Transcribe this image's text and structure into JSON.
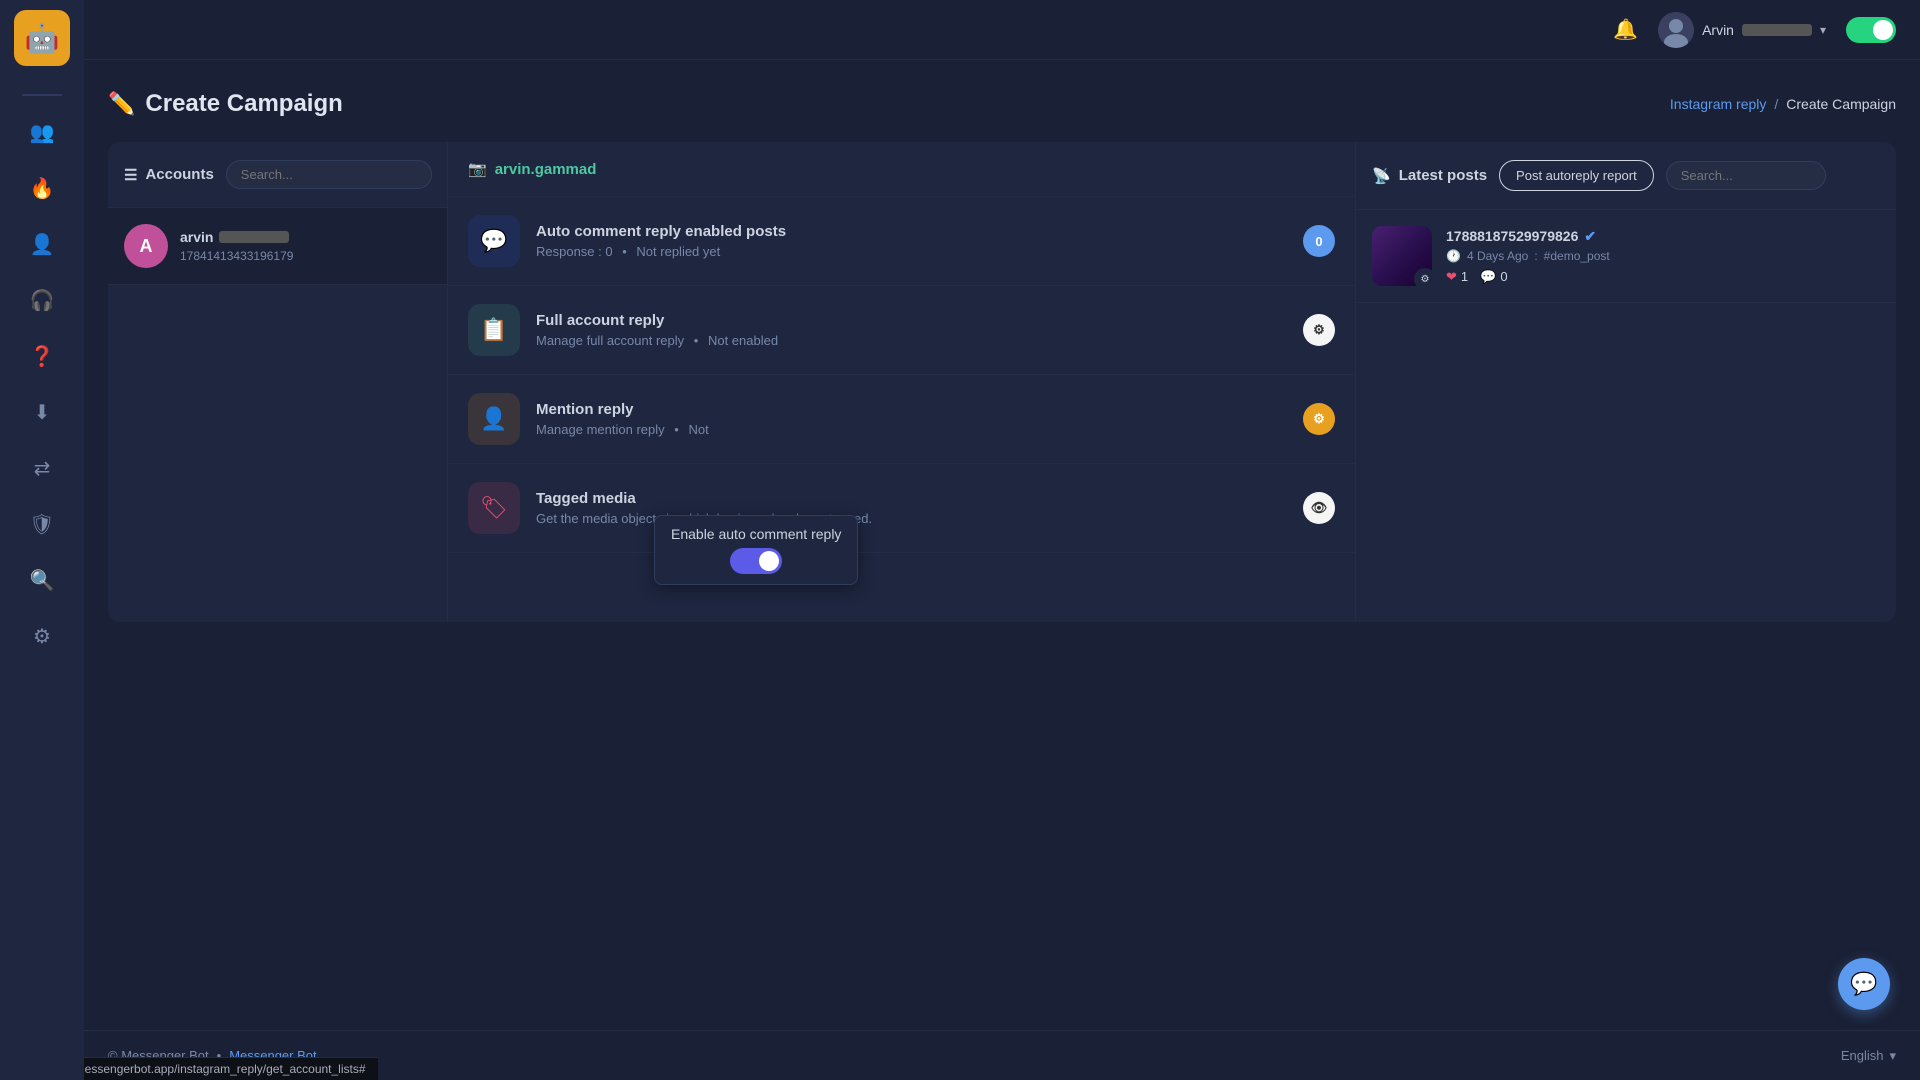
{
  "topnav": {
    "hamburger": "☰",
    "bell": "🔔",
    "username": "Arvin",
    "username_blur": "████████",
    "toggle_state": "on"
  },
  "sidebar": {
    "logo_emoji": "🤖",
    "items": [
      {
        "id": "users",
        "icon": "👥",
        "active": false
      },
      {
        "id": "fire",
        "icon": "🔥",
        "active": false
      },
      {
        "id": "person",
        "icon": "👤",
        "active": false
      },
      {
        "id": "headset",
        "icon": "🎧",
        "active": false
      },
      {
        "id": "help",
        "icon": "❓",
        "active": false
      },
      {
        "id": "download",
        "icon": "⬇️",
        "active": false
      },
      {
        "id": "flow",
        "icon": "⇄",
        "active": false
      },
      {
        "id": "shield",
        "icon": "🛡",
        "active": false
      },
      {
        "id": "search",
        "icon": "🔍",
        "active": false
      },
      {
        "id": "settings",
        "icon": "⚙️",
        "active": false
      }
    ]
  },
  "page": {
    "title": "Create Campaign",
    "title_icon": "✏️",
    "breadcrumb_link": "Instagram reply",
    "breadcrumb_sep": "/",
    "breadcrumb_current": "Create Campaign"
  },
  "accounts_col": {
    "title_icon": "☰",
    "title": "Accounts",
    "search_placeholder": "Search...",
    "account": {
      "initial": "A",
      "name": "arvin",
      "name_blur": true,
      "id": "17841413433196179",
      "avatar_color": "#c0509a"
    }
  },
  "features_col": {
    "account_name": "arvin.gammad",
    "account_icon": "📷",
    "features": [
      {
        "id": "auto-comment",
        "icon": "💬",
        "icon_style": "blue",
        "name": "Auto comment reply enabled posts",
        "desc_prefix": "Response : 0",
        "desc_suffix": "Not replied yet",
        "badge_style": "badge-blue",
        "badge_content": "0"
      },
      {
        "id": "full-account",
        "icon": "📋",
        "icon_style": "teal",
        "name": "Full account reply",
        "desc_prefix": "Manage full account reply",
        "desc_suffix": "Not enabled",
        "badge_style": "badge-gear",
        "badge_content": "⚙"
      },
      {
        "id": "mention",
        "icon": "👤",
        "icon_style": "orange",
        "name": "Mention reply",
        "desc_prefix": "Manage mention reply",
        "desc_suffix": "Not",
        "badge_style": "badge-orange",
        "badge_content": "⚙"
      },
      {
        "id": "tagged-media",
        "icon": "🏷",
        "icon_style": "pink",
        "name": "Tagged media",
        "desc": "Get the media objects in which business has been tagged.",
        "badge_style": "badge-eye",
        "badge_content": "👁"
      }
    ]
  },
  "tooltip": {
    "text": "Enable auto comment reply",
    "toggle_on": false
  },
  "posts_col": {
    "title_icon": "📡",
    "title": "Latest posts",
    "autoreply_btn": "Post autoreply report",
    "search_placeholder": "Search...",
    "posts": [
      {
        "id": "17888187529979826",
        "verified": true,
        "time_ago": "4 Days Ago",
        "tag": "#demo_post",
        "hearts": "1",
        "comments": "0"
      }
    ]
  },
  "footer": {
    "copyright": "© Messenger Bot",
    "separator": "•",
    "link_text": "Messenger Bot",
    "lang": "English",
    "lang_caret": "▾"
  },
  "url_bar": {
    "url": "https://start.messengerbot.app/instagram_reply/get_account_lists#"
  },
  "chat_fab": {
    "icon": "💬"
  }
}
